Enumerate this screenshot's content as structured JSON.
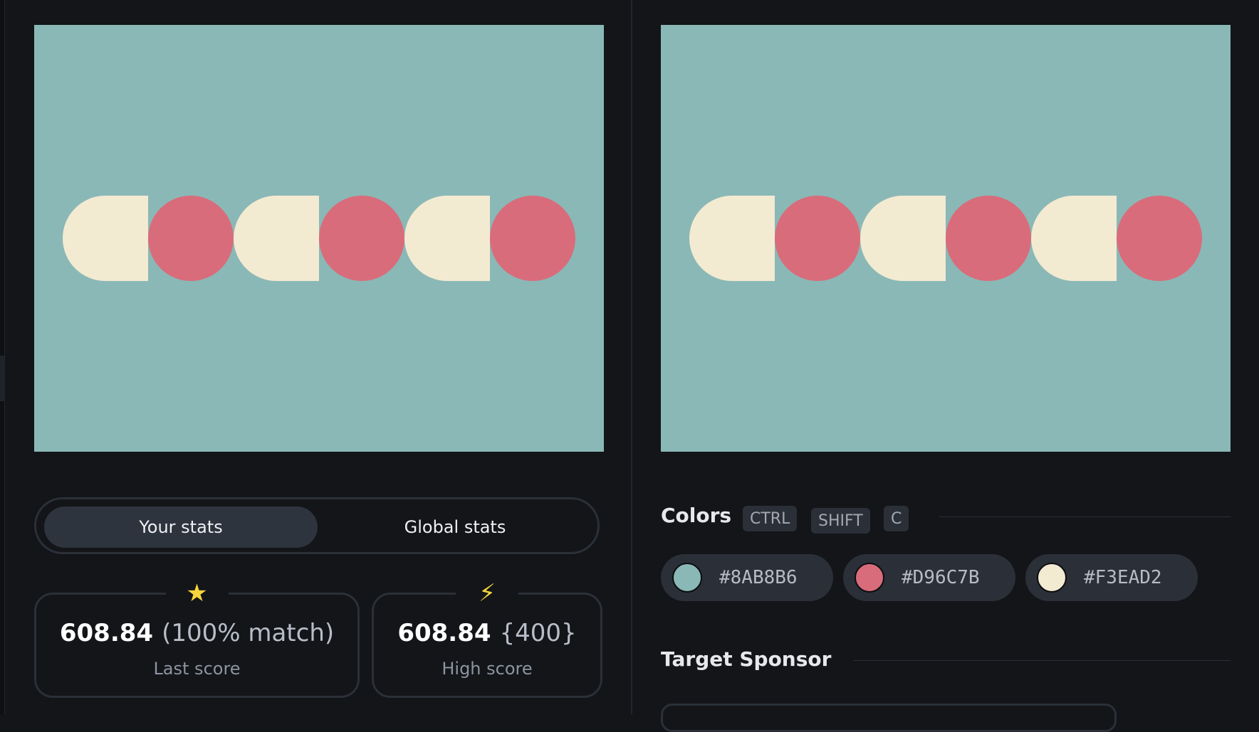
{
  "colors": {
    "background": "#8AB8B6",
    "circle": "#D96C7B",
    "half": "#F3EAD2",
    "accent_star": "#F6D53A"
  },
  "shapes": [
    "half",
    "circle",
    "half",
    "circle",
    "half",
    "circle"
  ],
  "stats_toggle": {
    "your_stats": "Your stats",
    "global_stats": "Global stats"
  },
  "last_score": {
    "icon": "star-icon",
    "glyph": "★",
    "value": "608.84",
    "extra": "(100% match)",
    "label": "Last score"
  },
  "high_score": {
    "icon": "lightning-icon",
    "glyph": "⚡",
    "value": "608.84",
    "extra": "{400}",
    "label": "High score"
  },
  "colors_section": {
    "title": "Colors",
    "shortcut": [
      "CTRL",
      "SHIFT",
      "C"
    ],
    "chips": [
      {
        "hex": "#8AB8B6",
        "label": "#8AB8B6"
      },
      {
        "hex": "#D96C7B",
        "label": "#D96C7B"
      },
      {
        "hex": "#F3EAD2",
        "label": "#F3EAD2"
      }
    ]
  },
  "sponsor_section": {
    "title": "Target Sponsor"
  }
}
